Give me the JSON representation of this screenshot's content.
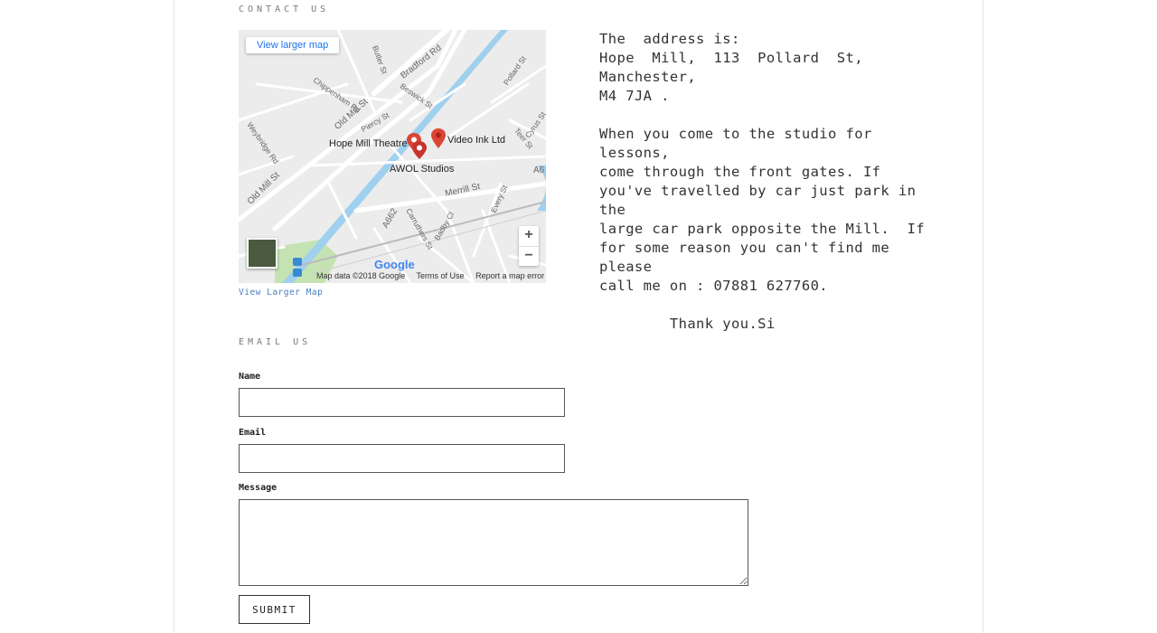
{
  "contact": {
    "heading": "CONTACT US",
    "map": {
      "view_larger_button": "View larger map",
      "view_larger_link": "View Larger Map",
      "places": {
        "hope_mill_theatre": "Hope Mill Theatre",
        "video_ink": "Video Ink Ltd",
        "awol_studios": "AWOL Studios"
      },
      "streets": {
        "bradford_rd": "Bradford Rd",
        "old_mill_st_1": "Old Mill St",
        "old_mill_st_2": "Old Mill St",
        "merrill_st": "Merrill St",
        "a662": "A662",
        "a6": "A6",
        "pollard_st": "Pollard St",
        "beswick_st": "Beswick St",
        "piercy_st": "Piercy St",
        "butler_st": "Butler St",
        "chippenham_rd": "Chippenham Rd",
        "weybridge_rd": "Weybridge Rd",
        "carruthers_st": "Carruthers St",
        "bradley_cl": "Badby Cl",
        "every_st": "Every St",
        "teer_st": "Teer St",
        "cyrus_st": "Cyrus St"
      },
      "zoom_in": "+",
      "zoom_out": "−",
      "google": "Google",
      "map_data": "Map data ©2018 Google",
      "terms": "Terms of Use",
      "report": "Report a map error"
    },
    "address_text": "The  address is:\nHope  Mill,  113  Pollard  St,  Manchester,\nM4 7JA .\n\nWhen you come to the studio for lessons,\ncome through the front gates. If\nyou've travelled by car just park in the\nlarge car park opposite the Mill.  If\nfor some reason you can't find me please\ncall me on : 07881 627760.\n\n        Thank you.Si"
  },
  "email": {
    "heading": "EMAIL US",
    "name_label": "Name",
    "email_label": "Email",
    "message_label": "Message",
    "name_value": "",
    "email_value": "",
    "message_value": "",
    "submit_label": "SUBMIT"
  }
}
